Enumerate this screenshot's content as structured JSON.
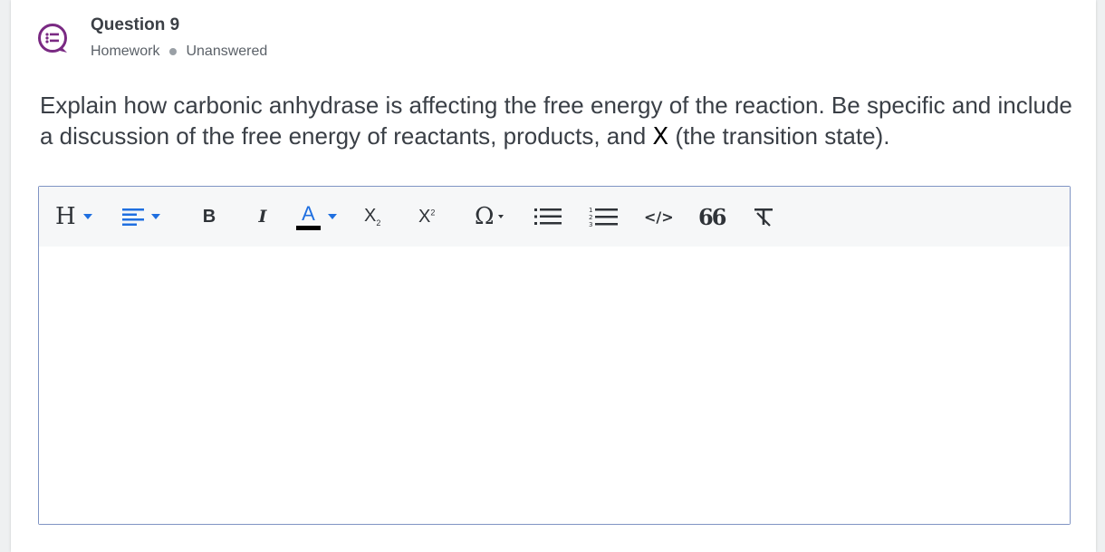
{
  "question": {
    "title": "Question 9",
    "category": "Homework",
    "status": "Unanswered",
    "text_before": "Explain how carbonic anhydrase is affecting the free energy of the reaction. Be specific and include a discussion of the free energy of reactants, products, and ",
    "symbol": "X",
    "text_after": " (the transition state)."
  },
  "toolbar": {
    "heading_label": "H",
    "bold_label": "B",
    "italic_label": "I",
    "font_color_label": "A",
    "subscript_label": "X",
    "subscript_sup": "2",
    "superscript_label": "X",
    "superscript_sup": "2",
    "special_char_label": "Ω",
    "code_label": "</>",
    "quote_label": "66"
  },
  "colors": {
    "accent": "#1f6fe0",
    "icon_purple": "#7a2a83",
    "editor_border": "#8094c4"
  }
}
